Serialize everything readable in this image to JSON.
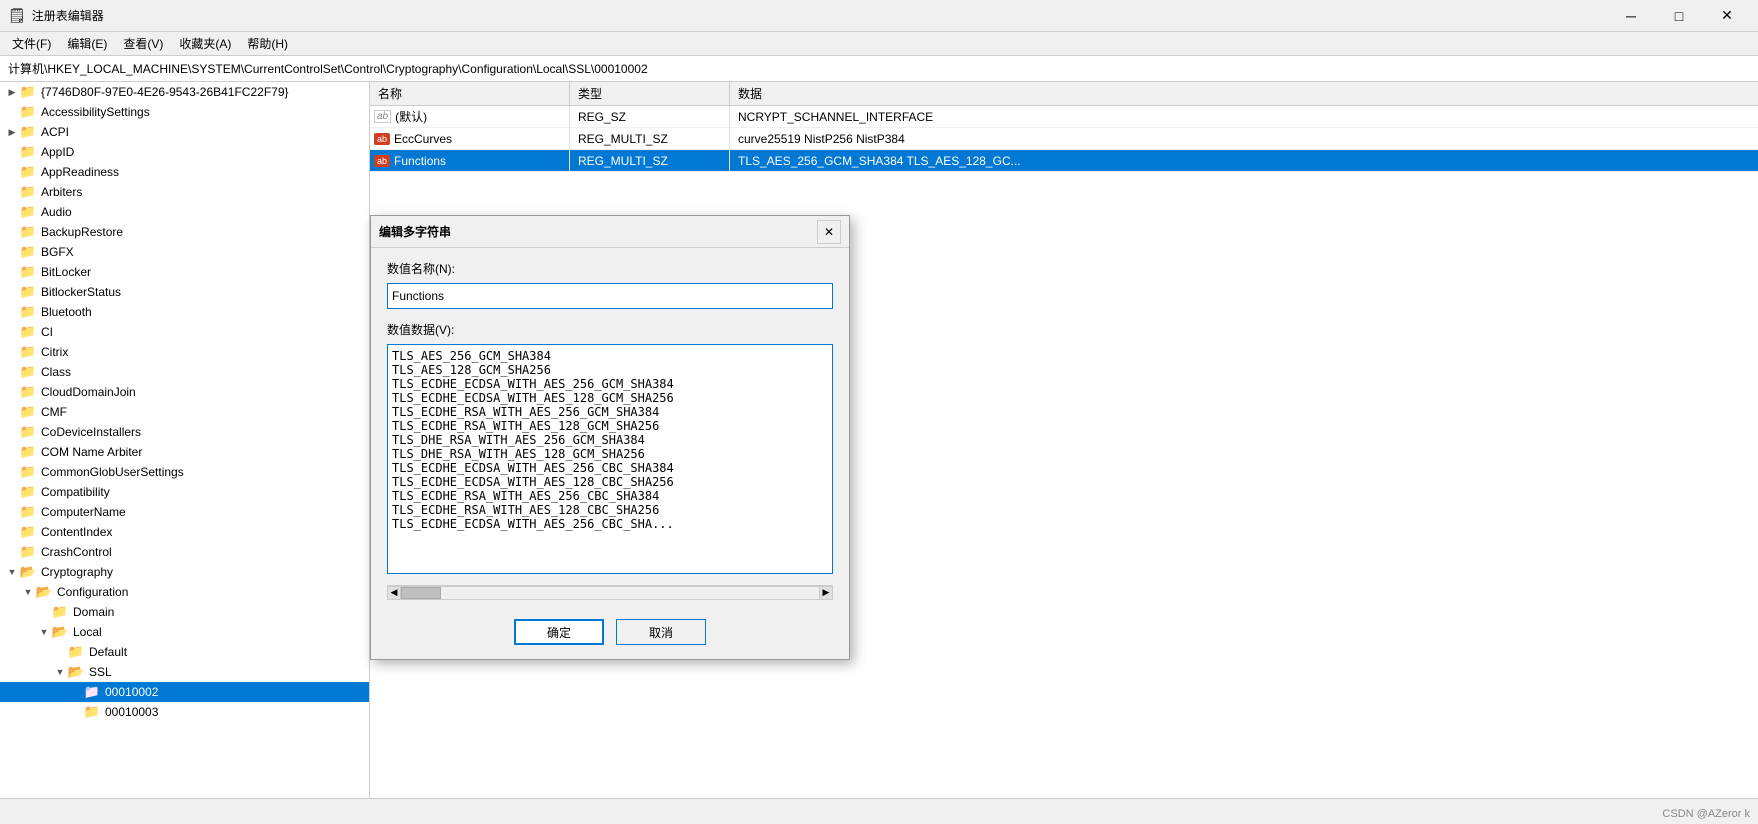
{
  "titleBar": {
    "icon": "🗒",
    "title": "注册表编辑器",
    "minimize": "─",
    "maximize": "□",
    "close": "✕"
  },
  "menuBar": {
    "items": [
      "文件(F)",
      "编辑(E)",
      "查看(V)",
      "收藏夹(A)",
      "帮助(H)"
    ]
  },
  "addressBar": {
    "label": "计算机\\HKEY_LOCAL_MACHINE\\SYSTEM\\CurrentControlSet\\Control\\Cryptography\\Configuration\\Local\\SSL\\00010002"
  },
  "treeItems": [
    {
      "indent": 0,
      "toggle": "▶",
      "name": "{7746D80F-97E0-4E26-9543-26B41FC22F79}",
      "expanded": false
    },
    {
      "indent": 0,
      "toggle": " ",
      "name": "AccessibilitySettings",
      "expanded": false
    },
    {
      "indent": 0,
      "toggle": "▶",
      "name": "ACPI",
      "expanded": false
    },
    {
      "indent": 0,
      "toggle": " ",
      "name": "AppID",
      "expanded": false
    },
    {
      "indent": 0,
      "toggle": " ",
      "name": "AppReadiness",
      "expanded": false
    },
    {
      "indent": 0,
      "toggle": " ",
      "name": "Arbiters",
      "expanded": false
    },
    {
      "indent": 0,
      "toggle": " ",
      "name": "Audio",
      "expanded": false
    },
    {
      "indent": 0,
      "toggle": " ",
      "name": "BackupRestore",
      "expanded": false
    },
    {
      "indent": 0,
      "toggle": " ",
      "name": "BGFX",
      "expanded": false
    },
    {
      "indent": 0,
      "toggle": " ",
      "name": "BitLocker",
      "expanded": false
    },
    {
      "indent": 0,
      "toggle": " ",
      "name": "BitlockerStatus",
      "expanded": false
    },
    {
      "indent": 0,
      "toggle": " ",
      "name": "Bluetooth",
      "expanded": false
    },
    {
      "indent": 0,
      "toggle": " ",
      "name": "CI",
      "expanded": false
    },
    {
      "indent": 0,
      "toggle": " ",
      "name": "Citrix",
      "expanded": false
    },
    {
      "indent": 0,
      "toggle": " ",
      "name": "Class",
      "expanded": false
    },
    {
      "indent": 0,
      "toggle": " ",
      "name": "CloudDomainJoin",
      "expanded": false
    },
    {
      "indent": 0,
      "toggle": " ",
      "name": "CMF",
      "expanded": false
    },
    {
      "indent": 0,
      "toggle": " ",
      "name": "CoDeviceInstallers",
      "expanded": false
    },
    {
      "indent": 0,
      "toggle": " ",
      "name": "COM Name Arbiter",
      "expanded": false
    },
    {
      "indent": 0,
      "toggle": " ",
      "name": "CommonGlobUserSettings",
      "expanded": false
    },
    {
      "indent": 0,
      "toggle": " ",
      "name": "Compatibility",
      "expanded": false
    },
    {
      "indent": 0,
      "toggle": " ",
      "name": "ComputerName",
      "expanded": false
    },
    {
      "indent": 0,
      "toggle": " ",
      "name": "ContentIndex",
      "expanded": false
    },
    {
      "indent": 0,
      "toggle": " ",
      "name": "CrashControl",
      "expanded": false
    },
    {
      "indent": 0,
      "toggle": "▼",
      "name": "Cryptography",
      "expanded": true
    },
    {
      "indent": 1,
      "toggle": "▼",
      "name": "Configuration",
      "expanded": true
    },
    {
      "indent": 2,
      "toggle": " ",
      "name": "Domain",
      "expanded": false
    },
    {
      "indent": 2,
      "toggle": "▼",
      "name": "Local",
      "expanded": true
    },
    {
      "indent": 3,
      "toggle": " ",
      "name": "Default",
      "expanded": false
    },
    {
      "indent": 3,
      "toggle": "▼",
      "name": "SSL",
      "expanded": true
    },
    {
      "indent": 4,
      "toggle": " ",
      "name": "00010002",
      "selected": true
    },
    {
      "indent": 4,
      "toggle": " ",
      "name": "00010003",
      "expanded": false
    }
  ],
  "tableHeaders": {
    "name": "名称",
    "type": "类型",
    "data": "数据"
  },
  "tableRows": [
    {
      "icon": "default",
      "name": "(默认)",
      "type": "REG_SZ",
      "data": "NCRYPT_SCHANNEL_INTERFACE"
    },
    {
      "icon": "multi",
      "name": "EccCurves",
      "type": "REG_MULTI_SZ",
      "data": "curve25519 NistP256 NistP384"
    },
    {
      "icon": "multi",
      "name": "Functions",
      "type": "REG_MULTI_SZ",
      "data": "TLS_AES_256_GCM_SHA384 TLS_AES_128_GC...",
      "selected": true
    }
  ],
  "dialog": {
    "title": "编辑多字符串",
    "closeBtn": "✕",
    "valueName": {
      "label": "数值名称(N):",
      "value": "Functions"
    },
    "valueData": {
      "label": "数值数据(V):",
      "lines": [
        "TLS_AES_256_GCM_SHA384",
        "TLS_AES_128_GCM_SHA256",
        "TLS_ECDHE_ECDSA_WITH_AES_256_GCM_SHA384",
        "TLS_ECDHE_ECDSA_WITH_AES_128_GCM_SHA256",
        "TLS_ECDHE_RSA_WITH_AES_256_GCM_SHA384",
        "TLS_ECDHE_RSA_WITH_AES_128_GCM_SHA256",
        "TLS_DHE_RSA_WITH_AES_256_GCM_SHA384",
        "TLS_DHE_RSA_WITH_AES_128_GCM_SHA256",
        "TLS_ECDHE_ECDSA_WITH_AES_256_CBC_SHA384",
        "TLS_ECDHE_ECDSA_WITH_AES_128_CBC_SHA256",
        "TLS_ECDHE_RSA_WITH_AES_256_CBC_SHA384",
        "TLS_ECDHE_RSA_WITH_AES_128_CBC_SHA256",
        "TLS_ECDHE_ECDSA_WITH_AES_256_CBC_SHA..."
      ]
    },
    "confirmBtn": "确定",
    "cancelBtn": "取消"
  },
  "statusBar": {
    "text": ""
  },
  "watermark": "CSDN @AZeror k"
}
